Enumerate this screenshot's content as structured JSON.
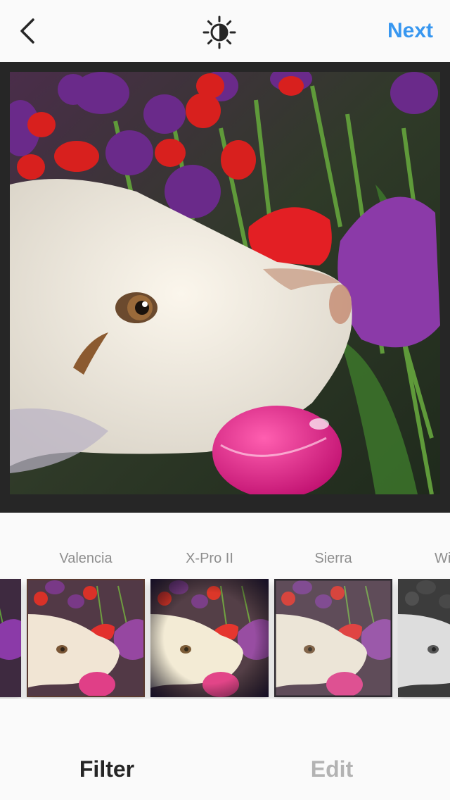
{
  "header": {
    "back_icon": "chevron-left-icon",
    "lux_icon": "sun-half-icon",
    "next_label": "Next",
    "next_color": "#3897f0"
  },
  "filters": [
    {
      "label": "",
      "tint": "normal"
    },
    {
      "label": "Valencia",
      "tint": "warm"
    },
    {
      "label": "X-Pro II",
      "tint": "vignette"
    },
    {
      "label": "Sierra",
      "tint": "faded"
    },
    {
      "label": "Wi",
      "tint": "mono"
    }
  ],
  "tabs": {
    "filter_label": "Filter",
    "edit_label": "Edit"
  }
}
